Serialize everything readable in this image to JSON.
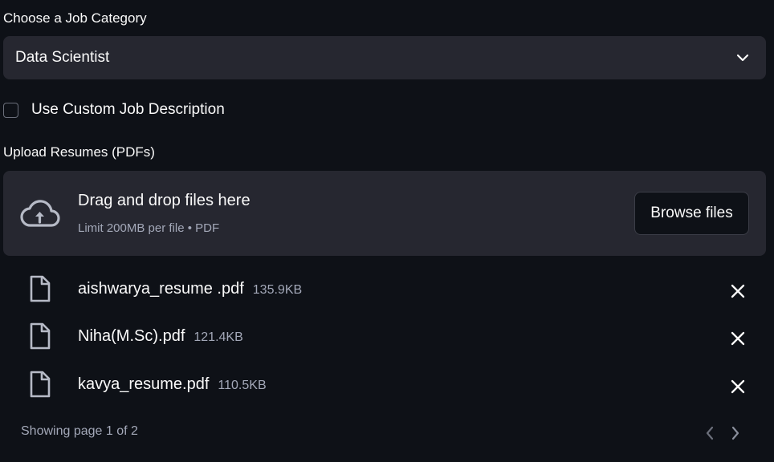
{
  "job_category": {
    "label": "Choose a Job Category",
    "selected": "Data Scientist"
  },
  "custom_description": {
    "label": "Use Custom Job Description",
    "checked": false
  },
  "uploader": {
    "label": "Upload Resumes (PDFs)",
    "dropzone_title": "Drag and drop files here",
    "dropzone_subtitle": "Limit 200MB per file • PDF",
    "browse_label": "Browse files",
    "files": [
      {
        "name": "aishwarya_resume .pdf",
        "size": "135.9KB"
      },
      {
        "name": "Niha(M.Sc).pdf",
        "size": "121.4KB"
      },
      {
        "name": "kavya_resume.pdf",
        "size": "110.5KB"
      }
    ],
    "pagination": "Showing page 1 of 2"
  },
  "icons": {
    "chevron": "chevron-down-icon",
    "upload": "cloud-upload-icon",
    "file": "file-icon",
    "remove": "close-icon",
    "prev": "chevron-left-icon",
    "next": "chevron-right-icon"
  },
  "colors": {
    "background": "#0e1117",
    "surface": "#262730",
    "text": "#fafafa",
    "muted": "#a3a8b8"
  }
}
